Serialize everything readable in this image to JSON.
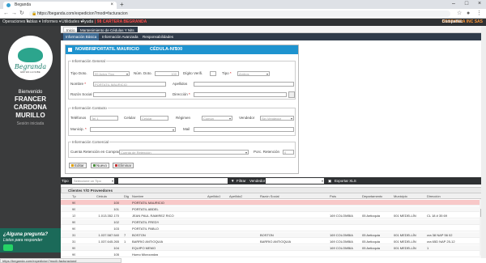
{
  "browser": {
    "tab_title": "Beganda",
    "url": "https://beganda.com/expedicion?modi=facturacion",
    "status_url": "https://beganda.com/expedicion?modi=facturacion#"
  },
  "menubar": {
    "items": [
      "Operaciones ▾",
      "Tablas ▾",
      "Informes ▾",
      "Utilidades ▾",
      "Ayuda"
    ],
    "app_title": "| 98 CARTERA BEGRANDA",
    "company_label": "Compañia:",
    "company_value": "BEGRANDA INC SAS"
  },
  "sidebar": {
    "brand": "Begranda",
    "tagline": "ERP EN LA NUBE",
    "welcome": "Bienvenido",
    "user_lines": [
      "FRANCER",
      "CARDONA",
      "MURILLO"
    ],
    "session": "Sesión iniciada",
    "chat_line1": "¿Alguna pregunta?",
    "chat_line2": "Listos para responder"
  },
  "breadcrumb": {
    "items": [
      "Inicio",
      "Mantenimiento de Cédulas Y Nits"
    ]
  },
  "subtabs": [
    "Información Básica",
    "Información Avanzada",
    "Responsabilidades"
  ],
  "panel": {
    "name_label": "NOMBRE",
    "name_value": "PORTATIL MAURICIO",
    "id_label": "CÉDULA-NIT",
    "id_value": "100"
  },
  "general": {
    "legend": "Información General",
    "tipo_doc_label": "Tipo Doto.",
    "tipo_doc_value": "99 Actos Tipo",
    "num_doc_label": "Núm. Doto.",
    "num_doc_value": "100",
    "digito_label": "Dígito Verifi.",
    "tipo_label": "Tipo",
    "tipo_value": "Ambos",
    "nombre_label": "Nombre",
    "nombre_value": "PORTATIL MAURICIO",
    "apellidos_label": "Apellidos",
    "razon_label": "Razón Social",
    "direccion_label": "Dirección"
  },
  "contacto": {
    "legend": "Información Contacto",
    "telefonos_label": "Teléfonos",
    "telefonos_value": "Tel 1",
    "celular_label": "Celular",
    "celular_value": "Celular",
    "regimen_label": "Régimen",
    "regimen_value": "Común",
    "vendedor_label": "Vendedor",
    "vendedor_value": "Sin Vendedor",
    "municipio_label": "Municip.",
    "mail_label": "Mail"
  },
  "comercial": {
    "legend": "Información Comercial",
    "cuenta_label": "Cuenta Retención en Compras",
    "cuenta_value": "Cuenta de Retención",
    "porc_label": "Porc. Retención",
    "porc_value": "0"
  },
  "buttons": {
    "edit": "Editar",
    "new": "Nuevo",
    "delete": "Eliminar"
  },
  "filterbar": {
    "tipo_label": "Tipo",
    "tipo_value": "Seleccione un Tipo",
    "filtrar_label": "Filtrar",
    "vendedor_label": "Vendedor",
    "export_label": "Exportar XLS"
  },
  "grid": {
    "title": "Clientes Y/O Proveedores",
    "headers": [
      "Tp",
      "Cédula",
      "Dig",
      "Nombre",
      "Apellido1",
      "Apellido2",
      "Razón Social",
      "País",
      "Departamento",
      "Municipio",
      "Dirección"
    ],
    "rows": [
      [
        "99",
        "100",
        "",
        "PORTATIL MAURICIO",
        "",
        "",
        "",
        "",
        "",
        "",
        ""
      ],
      [
        "99",
        "101",
        "",
        "PORTATIL ABDEL",
        "",
        "",
        "",
        "",
        "",
        "",
        ""
      ],
      [
        "13",
        "1.013.352.170",
        "",
        "JEAN PAUL RAMIREZ RICO",
        "",
        "",
        "",
        "169 COLOMBIA",
        "05 Antioquia",
        "001 MEDELLÍN",
        "CL 18 # 35 69"
      ],
      [
        "99",
        "102",
        "",
        "PORTATIL FREDY",
        "",
        "",
        "",
        "",
        "",
        "",
        ""
      ],
      [
        "99",
        "103",
        "",
        "PORTATIL PABLO",
        "",
        "",
        "",
        "",
        "",
        "",
        ""
      ],
      [
        "31",
        "1.037.587.540",
        "7",
        "BOSTON",
        "",
        "",
        "BOSTON",
        "169 COLOMBIA",
        "05 Antioquia",
        "001 MEDELLÍN",
        "cra 38 NAP 56 02"
      ],
      [
        "31",
        "1.037.645.265",
        "1",
        "BARRIO ANTIOQUIA",
        "",
        "",
        "BARRIO ANTIOQUIA",
        "169 COLOMBIA",
        "05 Antioquia",
        "001 MEDELLÍN",
        "cra 65D NAP 25-12"
      ],
      [
        "99",
        "104",
        "",
        "EQUIPO MEMO",
        "",
        "",
        "",
        "169 COLOMBIA",
        "05 Antioquia",
        "001 MEDELLÍN",
        "1"
      ],
      [
        "99",
        "105",
        "",
        "Humo Microondas",
        "",
        "",
        "",
        "",
        "",
        "",
        ""
      ]
    ]
  }
}
